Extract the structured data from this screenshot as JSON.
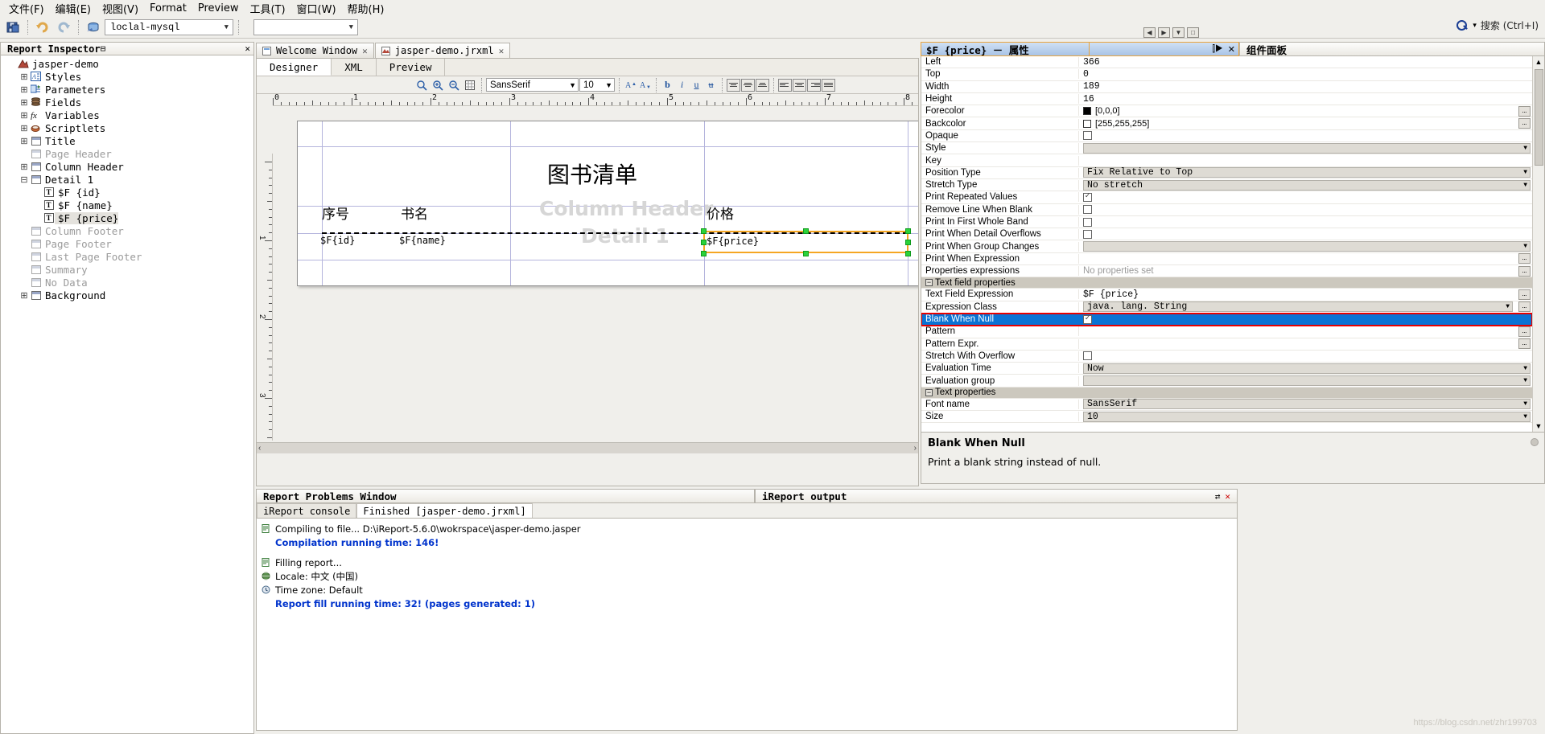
{
  "menu": {
    "items": [
      {
        "label": "文件(F)",
        "mnemonic": "F"
      },
      {
        "label": "编辑(E)",
        "mnemonic": "E"
      },
      {
        "label": "视图(V)",
        "mnemonic": "V"
      },
      {
        "label": "Format",
        "mnemonic": ""
      },
      {
        "label": "Preview",
        "mnemonic": ""
      },
      {
        "label": "工具(T)",
        "mnemonic": "T"
      },
      {
        "label": "窗口(W)",
        "mnemonic": "W"
      },
      {
        "label": "帮助(H)",
        "mnemonic": "H"
      }
    ]
  },
  "toolbar": {
    "datasource": "loclal-mysql",
    "second_combo": "",
    "search_placeholder": "搜索 (Ctrl+I)",
    "icons": [
      "save-icon",
      "undo-icon",
      "redo-icon",
      "datasource-icon"
    ]
  },
  "inspector": {
    "title": "Report Inspector",
    "nodes": [
      {
        "label": "jasper-demo",
        "indent": 0,
        "expander": "",
        "icon": "report-icon",
        "dim": false,
        "selected": false
      },
      {
        "label": "Styles",
        "indent": 1,
        "expander": "+",
        "icon": "styles-icon",
        "dim": false,
        "selected": false
      },
      {
        "label": "Parameters",
        "indent": 1,
        "expander": "+",
        "icon": "parameters-icon",
        "dim": false,
        "selected": false
      },
      {
        "label": "Fields",
        "indent": 1,
        "expander": "+",
        "icon": "fields-icon",
        "dim": false,
        "selected": false
      },
      {
        "label": "Variables",
        "indent": 1,
        "expander": "+",
        "icon": "variables-icon",
        "dim": false,
        "selected": false
      },
      {
        "label": "Scriptlets",
        "indent": 1,
        "expander": "+",
        "icon": "scriptlets-icon",
        "dim": false,
        "selected": false
      },
      {
        "label": "Title",
        "indent": 1,
        "expander": "+",
        "icon": "band-icon",
        "dim": false,
        "selected": false
      },
      {
        "label": "Page Header",
        "indent": 1,
        "expander": "",
        "icon": "band-icon",
        "dim": true,
        "selected": false
      },
      {
        "label": "Column Header",
        "indent": 1,
        "expander": "+",
        "icon": "band-icon",
        "dim": false,
        "selected": false
      },
      {
        "label": "Detail 1",
        "indent": 1,
        "expander": "-",
        "icon": "band-icon",
        "dim": false,
        "selected": false
      },
      {
        "label": "$F {id}",
        "indent": 2,
        "expander": "",
        "icon": "textfield-icon",
        "dim": false,
        "selected": false
      },
      {
        "label": "$F {name}",
        "indent": 2,
        "expander": "",
        "icon": "textfield-icon",
        "dim": false,
        "selected": false
      },
      {
        "label": "$F {price}",
        "indent": 2,
        "expander": "",
        "icon": "textfield-icon",
        "dim": false,
        "selected": true
      },
      {
        "label": "Column Footer",
        "indent": 1,
        "expander": "",
        "icon": "band-icon",
        "dim": true,
        "selected": false
      },
      {
        "label": "Page Footer",
        "indent": 1,
        "expander": "",
        "icon": "band-icon",
        "dim": true,
        "selected": false
      },
      {
        "label": "Last Page Footer",
        "indent": 1,
        "expander": "",
        "icon": "band-icon",
        "dim": true,
        "selected": false
      },
      {
        "label": "Summary",
        "indent": 1,
        "expander": "",
        "icon": "band-icon",
        "dim": true,
        "selected": false
      },
      {
        "label": "No Data",
        "indent": 1,
        "expander": "",
        "icon": "band-icon",
        "dim": true,
        "selected": false
      },
      {
        "label": "Background",
        "indent": 1,
        "expander": "+",
        "icon": "band-icon",
        "dim": false,
        "selected": false
      }
    ]
  },
  "editor": {
    "tabs": [
      {
        "label": "Welcome Window",
        "active": false,
        "icon": "welcome-icon"
      },
      {
        "label": "jasper-demo.jrxml",
        "active": true,
        "icon": "jrxml-icon"
      }
    ],
    "view_tabs": [
      {
        "label": "Designer",
        "active": true
      },
      {
        "label": "XML",
        "active": false
      },
      {
        "label": "Preview",
        "active": false
      }
    ],
    "font_name": "SansSerif",
    "font_size": "10",
    "ruler_numbers": [
      "0",
      "1",
      "2",
      "3",
      "4",
      "5",
      "6",
      "7",
      "8"
    ],
    "vruler_numbers": [
      "1",
      "2",
      "3"
    ]
  },
  "canvas": {
    "report_title": "图书清单",
    "column_headers": [
      "序号",
      "书名",
      "价格"
    ],
    "detail_fields": [
      "$F{id}",
      "$F{name}",
      "$F{price}"
    ],
    "band_watermarks": [
      "Column Header",
      "Detail 1"
    ]
  },
  "properties": {
    "title": "$F {price} － 属性",
    "component_palette_title": "组件面板",
    "rows": [
      {
        "name": "Left",
        "value": "366",
        "type": "text"
      },
      {
        "name": "Top",
        "value": "0",
        "type": "text"
      },
      {
        "name": "Width",
        "value": "189",
        "type": "text"
      },
      {
        "name": "Height",
        "value": "16",
        "type": "text"
      },
      {
        "name": "Forecolor",
        "value": "[0,0,0]",
        "type": "color",
        "color": "#000000",
        "dots": true
      },
      {
        "name": "Backcolor",
        "value": "[255,255,255]",
        "type": "color",
        "color": "#ffffff",
        "dots": true
      },
      {
        "name": "Opaque",
        "value": "",
        "type": "checkbox",
        "checked": false
      },
      {
        "name": "Style",
        "value": "",
        "type": "dropdown"
      },
      {
        "name": "Key",
        "value": "",
        "type": "text"
      },
      {
        "name": "Position Type",
        "value": "Fix Relative to Top",
        "type": "dropdown"
      },
      {
        "name": "Stretch Type",
        "value": "No stretch",
        "type": "dropdown"
      },
      {
        "name": "Print Repeated Values",
        "value": "",
        "type": "checkbox",
        "checked": true
      },
      {
        "name": "Remove Line When Blank",
        "value": "",
        "type": "checkbox",
        "checked": false
      },
      {
        "name": "Print In First Whole Band",
        "value": "",
        "type": "checkbox",
        "checked": false
      },
      {
        "name": "Print When Detail Overflows",
        "value": "",
        "type": "checkbox",
        "checked": false
      },
      {
        "name": "Print When Group Changes",
        "value": "",
        "type": "dropdown"
      },
      {
        "name": "Print When Expression",
        "value": "",
        "type": "text",
        "dots": true
      },
      {
        "name": "Properties expressions",
        "value": "No properties set",
        "type": "muted",
        "dots": true
      },
      {
        "name": "Text field properties",
        "value": "",
        "type": "group"
      },
      {
        "name": "Text Field Expression",
        "value": "$F {price}",
        "type": "text",
        "dots": true
      },
      {
        "name": "Expression Class",
        "value": "java. lang. String",
        "type": "dropdown",
        "dots": true
      },
      {
        "name": "Blank When Null",
        "value": "",
        "type": "checkbox",
        "checked": true,
        "selected": true,
        "highlighted": true
      },
      {
        "name": "Pattern",
        "value": "",
        "type": "text",
        "dots": true
      },
      {
        "name": "Pattern Expr.",
        "value": "",
        "type": "text",
        "dots": true
      },
      {
        "name": "Stretch With Overflow",
        "value": "",
        "type": "checkbox",
        "checked": false
      },
      {
        "name": "Evaluation Time",
        "value": "Now",
        "type": "dropdown"
      },
      {
        "name": "Evaluation group",
        "value": "",
        "type": "dropdown"
      },
      {
        "name": "Text properties",
        "value": "",
        "type": "group"
      },
      {
        "name": "Font name",
        "value": "SansSerif",
        "type": "dropdown"
      },
      {
        "name": "Size",
        "value": "10",
        "type": "dropdown"
      }
    ],
    "help": {
      "title": "Blank When Null",
      "text": "Print a blank string instead of null."
    }
  },
  "bottom": {
    "problems_tab": "Report Problems Window",
    "output_tab": "iReport output",
    "console_tabs": [
      {
        "label": "iReport console",
        "active": false
      },
      {
        "label": "Finished [jasper-demo.jrxml]",
        "active": true
      }
    ],
    "console_lines": [
      {
        "text": "Compiling to file... D:\\iReport-5.6.0\\wokrspace\\jasper-demo.jasper",
        "style": "normal",
        "icon": "doc-icon"
      },
      {
        "text": "Compilation running time: 146!",
        "style": "blue",
        "icon": ""
      },
      {
        "text": "",
        "style": "spacer",
        "icon": ""
      },
      {
        "text": "Filling report...",
        "style": "normal",
        "icon": "doc-icon"
      },
      {
        "text": "Locale: 中文 (中国)",
        "style": "normal",
        "icon": "globe-icon"
      },
      {
        "text": "Time zone: Default",
        "style": "normal",
        "icon": "clock-icon"
      },
      {
        "text": "Report fill running time: 32! (pages generated: 1)",
        "style": "blue",
        "icon": ""
      }
    ]
  },
  "watermark": "https://blog.csdn.net/zhr199703"
}
